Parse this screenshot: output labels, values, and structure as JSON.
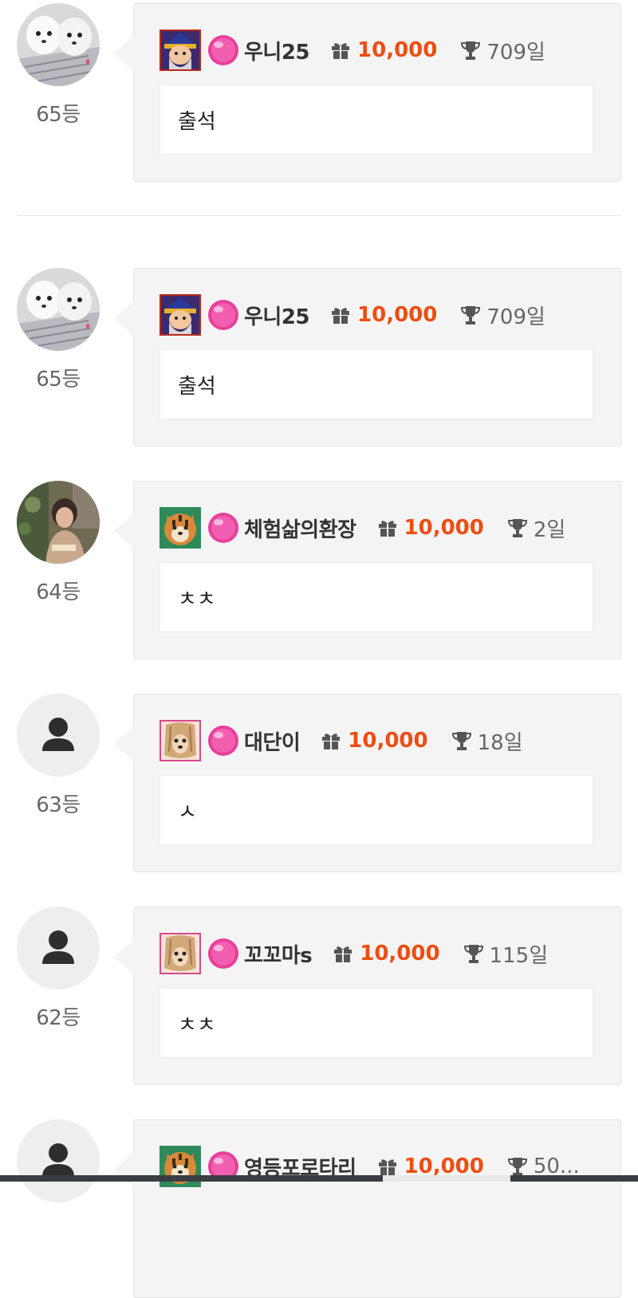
{
  "entries": [
    {
      "rank": "65등",
      "nickname": "우니25",
      "points": "10,000",
      "days": "709일",
      "message": "출석",
      "avatar": "dogs",
      "level": "wizard"
    },
    {
      "rank": "65등",
      "nickname": "우니25",
      "points": "10,000",
      "days": "709일",
      "message": "출석",
      "avatar": "dogs",
      "level": "wizard"
    },
    {
      "rank": "64등",
      "nickname": "체험삶의환장",
      "points": "10,000",
      "days": "2일",
      "message": "ㅊㅊ",
      "avatar": "person",
      "level": "tiger"
    },
    {
      "rank": "63등",
      "nickname": "대단이",
      "points": "10,000",
      "days": "18일",
      "message": "ㅅ",
      "avatar": "default",
      "level": "yorkie"
    },
    {
      "rank": "62등",
      "nickname": "꼬꼬마s",
      "points": "10,000",
      "days": "115일",
      "message": "ㅊㅊ",
      "avatar": "default",
      "level": "yorkie"
    },
    {
      "rank": "",
      "nickname": "영등포로타리",
      "points": "10,000",
      "days": "50...",
      "message": "",
      "avatar": "default",
      "level": "tiger"
    }
  ],
  "icons": {
    "gift": "gift-icon",
    "trophy": "trophy-icon",
    "gem": "pink-gem-icon",
    "default_avatar": "user-silhouette-icon"
  },
  "colors": {
    "points": "#ee4d12",
    "bubble": "#f4f4f4",
    "rank": "#666666"
  }
}
